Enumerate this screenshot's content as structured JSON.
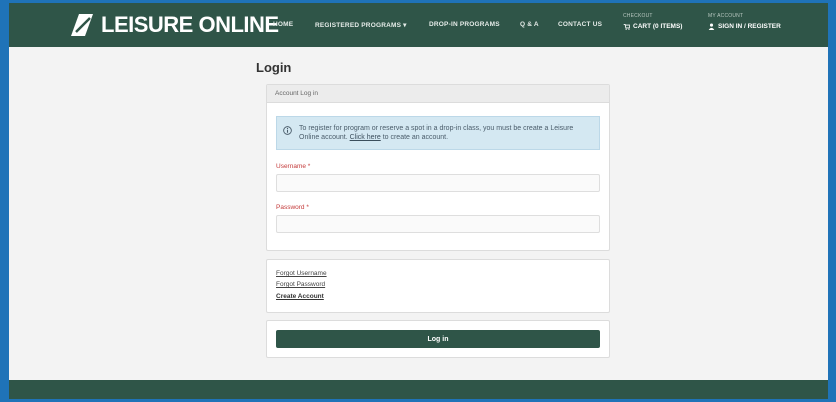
{
  "brand": {
    "logo_text": "LEISURE ONLINE"
  },
  "nav": {
    "home": "HOME",
    "registered_programs": "REGISTERED PROGRAMS ▾",
    "drop_in_programs": "DROP-IN PROGRAMS",
    "qa": "Q & A",
    "contact_us": "CONTACT US",
    "checkout_label": "CHECKOUT",
    "cart": "CART (0 ITEMS)",
    "my_account_label": "MY ACCOUNT",
    "sign_in": "SIGN IN / REGISTER"
  },
  "page": {
    "title": "Login"
  },
  "login_card": {
    "header": "Account Log in",
    "alert_text": "To register for program or reserve a spot in a drop-in class, you must be create a Leisure Online account.",
    "alert_link": "Click here",
    "alert_suffix": "to create an account.",
    "username_label": "Username *",
    "password_label": "Password *",
    "username_value": "",
    "password_value": ""
  },
  "links_card": {
    "forgot_username": "Forgot Username",
    "forgot_password": "Forgot Password",
    "create_account": "Create Account"
  },
  "actions": {
    "login_button": "Log in"
  },
  "colors": {
    "brand_green": "#2f5548",
    "alert_blue": "#d4e8f2",
    "required_red": "#c43b3b"
  }
}
